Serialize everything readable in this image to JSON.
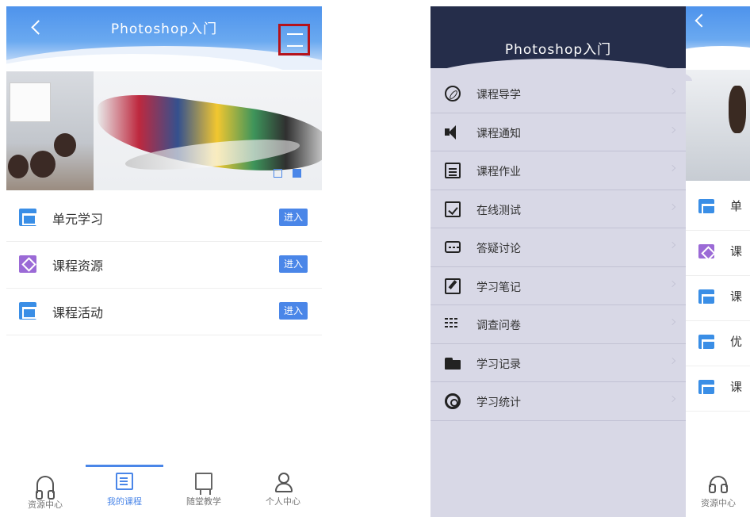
{
  "left": {
    "header": {
      "title": "Photoshop入门"
    },
    "banner": {
      "dots": [
        "inactive",
        "active"
      ]
    },
    "list": [
      {
        "label": "单元学习",
        "enter": "进入",
        "icon": "folder-icon"
      },
      {
        "label": "课程资源",
        "enter": "进入",
        "icon": "resource-icon"
      },
      {
        "label": "课程活动",
        "enter": "进入",
        "icon": "folder-icon"
      }
    ],
    "bottom_nav": [
      {
        "label": "资源中心",
        "icon": "headset-icon"
      },
      {
        "label": "我的课程",
        "icon": "book-icon",
        "active": true
      },
      {
        "label": "随堂教学",
        "icon": "board-icon"
      },
      {
        "label": "个人中心",
        "icon": "person-icon"
      }
    ]
  },
  "right": {
    "drawer": {
      "title": "Photoshop入门",
      "items": [
        {
          "label": "课程导学",
          "icon": "compass-icon"
        },
        {
          "label": "课程通知",
          "icon": "speaker-icon"
        },
        {
          "label": "课程作业",
          "icon": "clipboard-icon"
        },
        {
          "label": "在线测试",
          "icon": "checklist-icon"
        },
        {
          "label": "答疑讨论",
          "icon": "chat-icon"
        },
        {
          "label": "学习笔记",
          "icon": "note-icon"
        },
        {
          "label": "调查问卷",
          "icon": "survey-icon"
        },
        {
          "label": "学习记录",
          "icon": "folder-icon"
        },
        {
          "label": "学习统计",
          "icon": "stats-icon"
        }
      ]
    },
    "under": {
      "rows": [
        "单",
        "课",
        "课",
        "优",
        "课"
      ],
      "nav_label": "资源中心"
    }
  },
  "colors": {
    "accent": "#4a86e8",
    "drawer_header": "#252d4a",
    "drawer_bg": "#d8d8e6",
    "highlight": "#b5121b"
  }
}
